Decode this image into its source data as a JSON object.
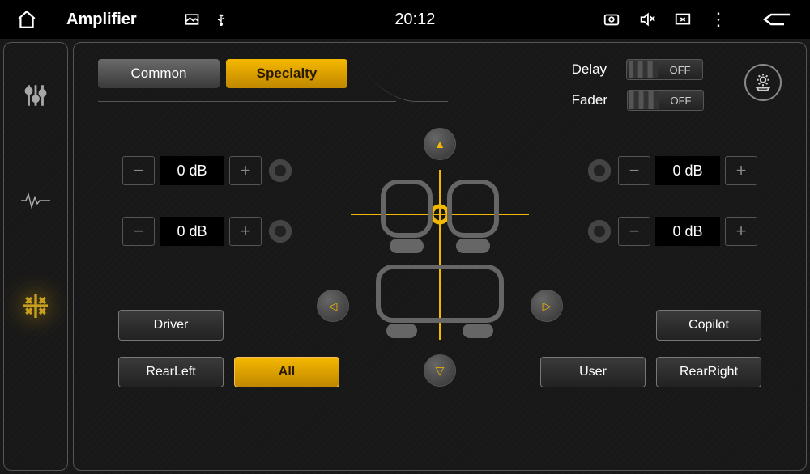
{
  "status": {
    "title": "Amplifier",
    "time": "20:12"
  },
  "tabs": {
    "common": "Common",
    "specialty": "Specialty"
  },
  "toggles": {
    "delay": {
      "label": "Delay",
      "state": "OFF"
    },
    "fader": {
      "label": "Fader",
      "state": "OFF"
    }
  },
  "channels": {
    "fl": "0 dB",
    "fr": "0 dB",
    "rl": "0 dB",
    "rr": "0 dB"
  },
  "presets": {
    "driver": "Driver",
    "rearleft": "RearLeft",
    "all": "All",
    "user": "User",
    "copilot": "Copilot",
    "rearright": "RearRight"
  }
}
